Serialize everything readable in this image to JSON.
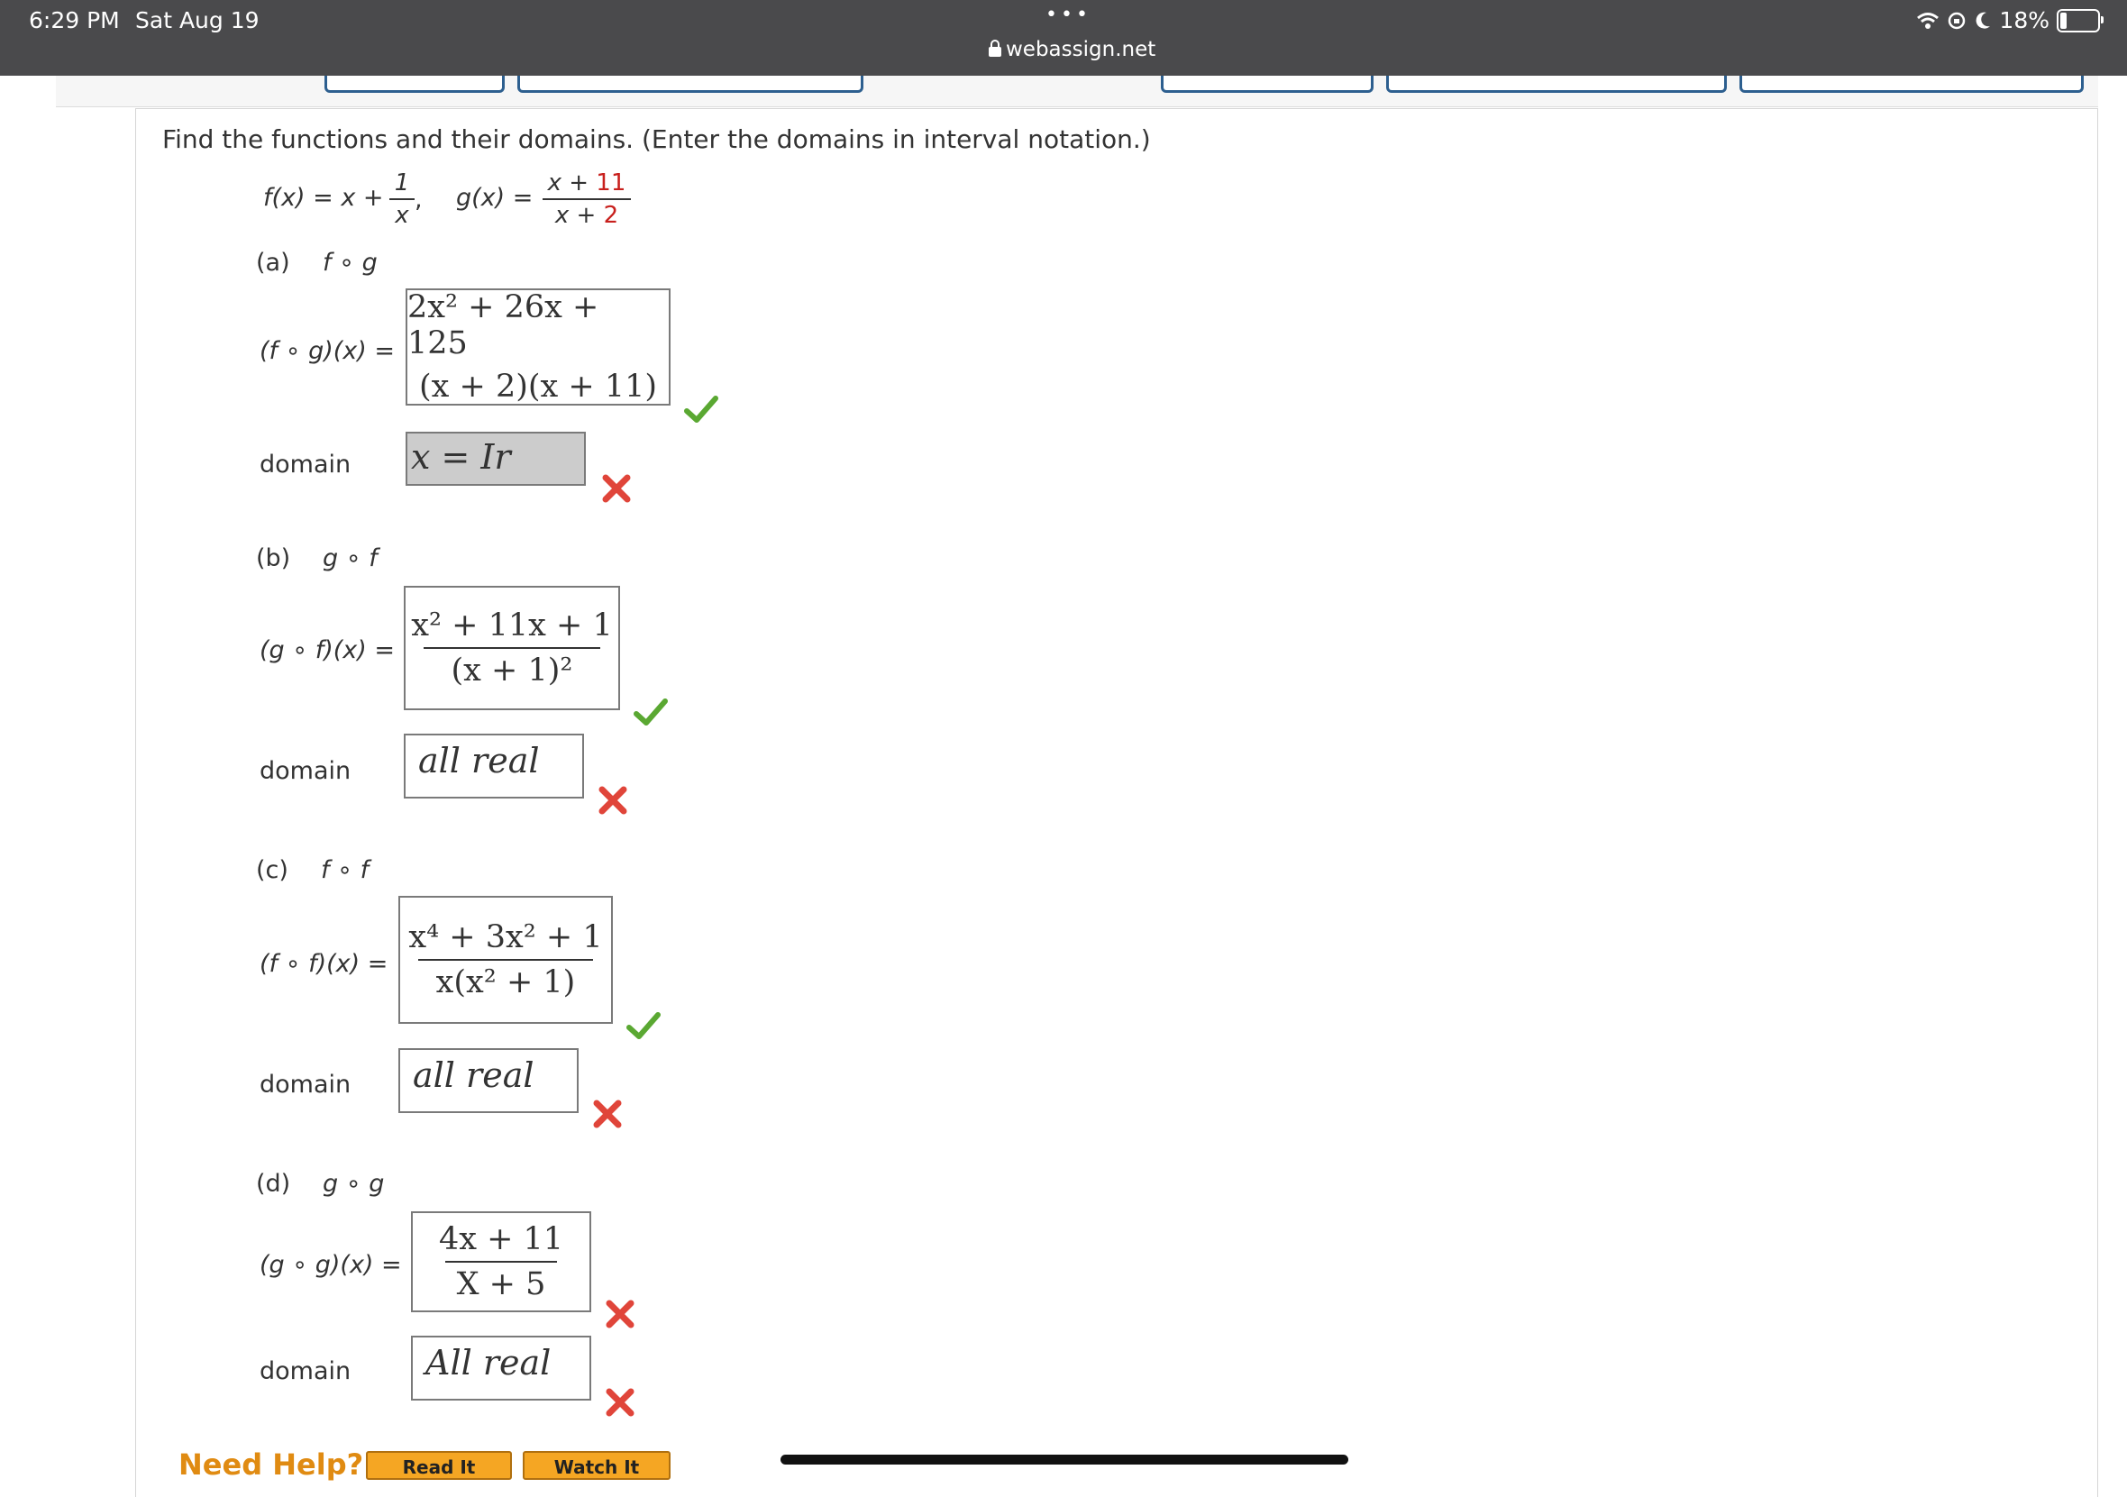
{
  "status_bar": {
    "time": "6:29 PM",
    "date": "Sat Aug 19",
    "dots": "•••",
    "url": "webassign.net",
    "battery": "18%",
    "battery_level": 0.18
  },
  "question": {
    "instruction": "Find the functions and their domains. (Enter the domains in interval notation.)",
    "f_def": {
      "lhs": "f(x) = x + ",
      "num": "1",
      "den": "x",
      "sep": ","
    },
    "g_def": {
      "lhs": "g(x) = ",
      "num_a": "x + ",
      "num_b": "11",
      "den_a": "x + ",
      "den_b": "2"
    }
  },
  "parts": [
    {
      "label": "(a)",
      "op": "f ∘ g",
      "expr_label": "(f ∘ g)(x) =",
      "domain_label": "domain",
      "answer": {
        "num": "2x² + 26x + 125",
        "den": "(x + 2)(x + 11)",
        "status": "correct"
      },
      "domain_answer": {
        "value": "x = Ir",
        "status": "incorrect"
      }
    },
    {
      "label": "(b)",
      "op": "g ∘ f",
      "expr_label": "(g ∘ f)(x) =",
      "domain_label": "domain",
      "answer": {
        "num": "x² + 11x + 1",
        "den": "(x + 1)²",
        "status": "correct"
      },
      "domain_answer": {
        "value": "all real",
        "status": "incorrect"
      }
    },
    {
      "label": "(c)",
      "op": "f ∘ f",
      "expr_label": "(f ∘ f)(x) =",
      "domain_label": "domain",
      "answer": {
        "num": "x⁴ + 3x² + 1",
        "den": "x(x² + 1)",
        "status": "correct"
      },
      "domain_answer": {
        "value": "all real",
        "status": "incorrect"
      }
    },
    {
      "label": "(d)",
      "op": "g ∘ g",
      "expr_label": "(g ∘ g)(x) =",
      "domain_label": "domain",
      "answer": {
        "num": "4x + 11",
        "den": "X + 5",
        "status": "incorrect"
      },
      "domain_answer": {
        "value": "All real",
        "status": "incorrect"
      }
    }
  ],
  "help": {
    "title": "Need Help?",
    "read_it": "Read It",
    "watch_it": "Watch It"
  },
  "colors": {
    "check": "#5aa832",
    "cross": "#e0453a",
    "help": "#e08b12",
    "button": "#f5a623",
    "status_bar": "#4a4a4c"
  },
  "icons": {
    "correct": "check-icon",
    "incorrect": "x-mark-icon"
  }
}
